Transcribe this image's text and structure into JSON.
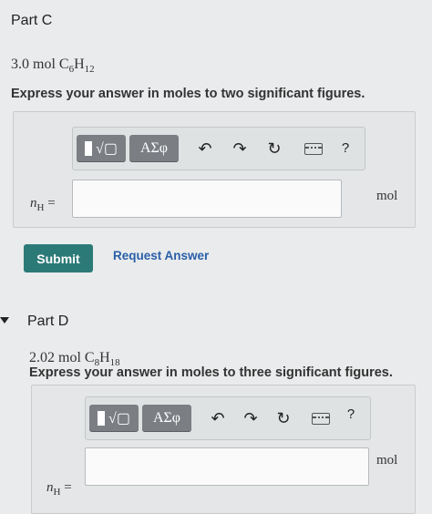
{
  "partC": {
    "title": "Part C",
    "quantity": "3.0 mol C",
    "formula_sub1": "6",
    "formula_mid": "H",
    "formula_sub2": "12",
    "prompt": "Express your answer in moles to two significant figures.",
    "answer_label_var": "n",
    "answer_label_sub": "H",
    "answer_label_eq": "=",
    "answer_value": "",
    "unit": "mol",
    "submit_label": "Submit",
    "request_label": "Request Answer"
  },
  "partD": {
    "title": "Part D",
    "quantity": "2.02 mol C",
    "formula_sub1": "8",
    "formula_mid": "H",
    "formula_sub2": "18",
    "prompt": "Express your answer in moles to three significant figures.",
    "answer_label_var": "n",
    "answer_label_sub": "H",
    "answer_label_eq": "=",
    "answer_value": "",
    "unit": "mol"
  },
  "toolbar": {
    "templates_label": "√▢",
    "greek_label": "ΑΣφ",
    "undo_icon": "undo-icon",
    "redo_icon": "redo-icon",
    "reset_icon": "reset-icon",
    "keyboard_icon": "keyboard-icon",
    "help_label": "?"
  },
  "colors": {
    "submit": "#2c7a78",
    "link": "#2a5fa8",
    "toolbar_button": "#7b7f84"
  }
}
